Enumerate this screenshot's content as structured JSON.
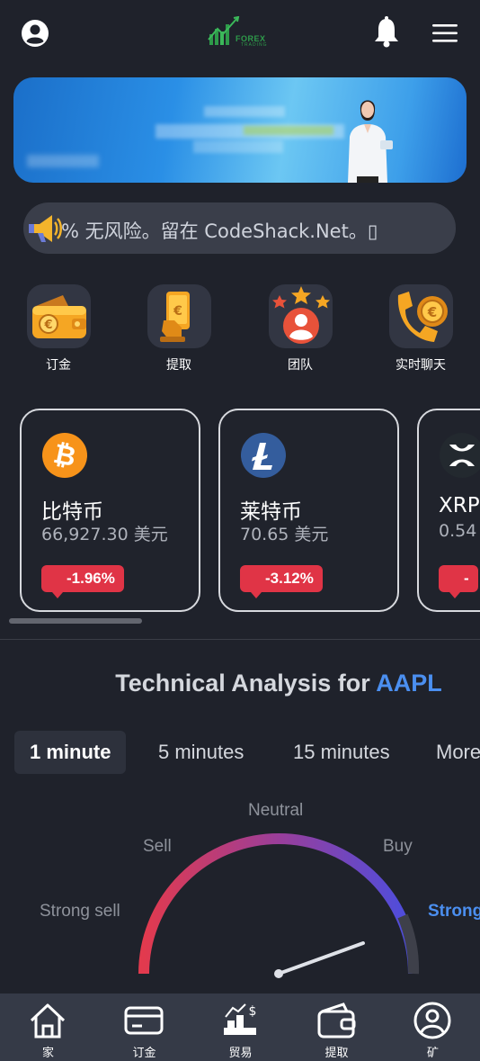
{
  "header": {
    "logo_text": "FOREX",
    "logo_subtext": "TRADING"
  },
  "notice": {
    "text": "% 无风险。留在 CodeShack.Net。▯"
  },
  "quick_actions": [
    {
      "label": "订金",
      "icon": "wallet-euro-icon"
    },
    {
      "label": "提取",
      "icon": "phone-withdraw-icon"
    },
    {
      "label": "团队",
      "icon": "team-stars-icon"
    },
    {
      "label": "实时聊天",
      "icon": "phone-support-icon"
    }
  ],
  "coins": [
    {
      "name": "比特币",
      "price": "66,927.30 美元",
      "change": "-1.96%",
      "icon": "bitcoin-icon",
      "color": "#f7931a"
    },
    {
      "name": "莱特币",
      "price": "70.65 美元",
      "change": "-3.12%",
      "icon": "litecoin-icon",
      "color": "#345d9d"
    },
    {
      "name": "XRP",
      "price": "0.54",
      "change": "-",
      "icon": "xrp-icon",
      "color": "#23292f"
    }
  ],
  "technical_analysis": {
    "title_prefix": "Technical Analysis for ",
    "symbol": "AAPL",
    "tabs": [
      "1 minute",
      "5 minutes",
      "15 minutes",
      "More"
    ],
    "active_tab": "1 minute",
    "gauge_labels": {
      "strong_sell": "Strong sell",
      "sell": "Sell",
      "neutral": "Neutral",
      "buy": "Buy",
      "strong_buy": "Strong"
    },
    "gauge_value_fraction": 0.9
  },
  "bottom_nav": [
    {
      "label": "家",
      "icon": "home-icon"
    },
    {
      "label": "订金",
      "icon": "card-icon"
    },
    {
      "label": "贸易",
      "icon": "trade-icon"
    },
    {
      "label": "提取",
      "icon": "wallet-icon"
    },
    {
      "label": "矿",
      "icon": "user-circle-icon"
    }
  ],
  "colors": {
    "background": "#1f222b",
    "negative": "#e03446",
    "accent": "#4b8ff0",
    "nav_background": "#353a47"
  }
}
